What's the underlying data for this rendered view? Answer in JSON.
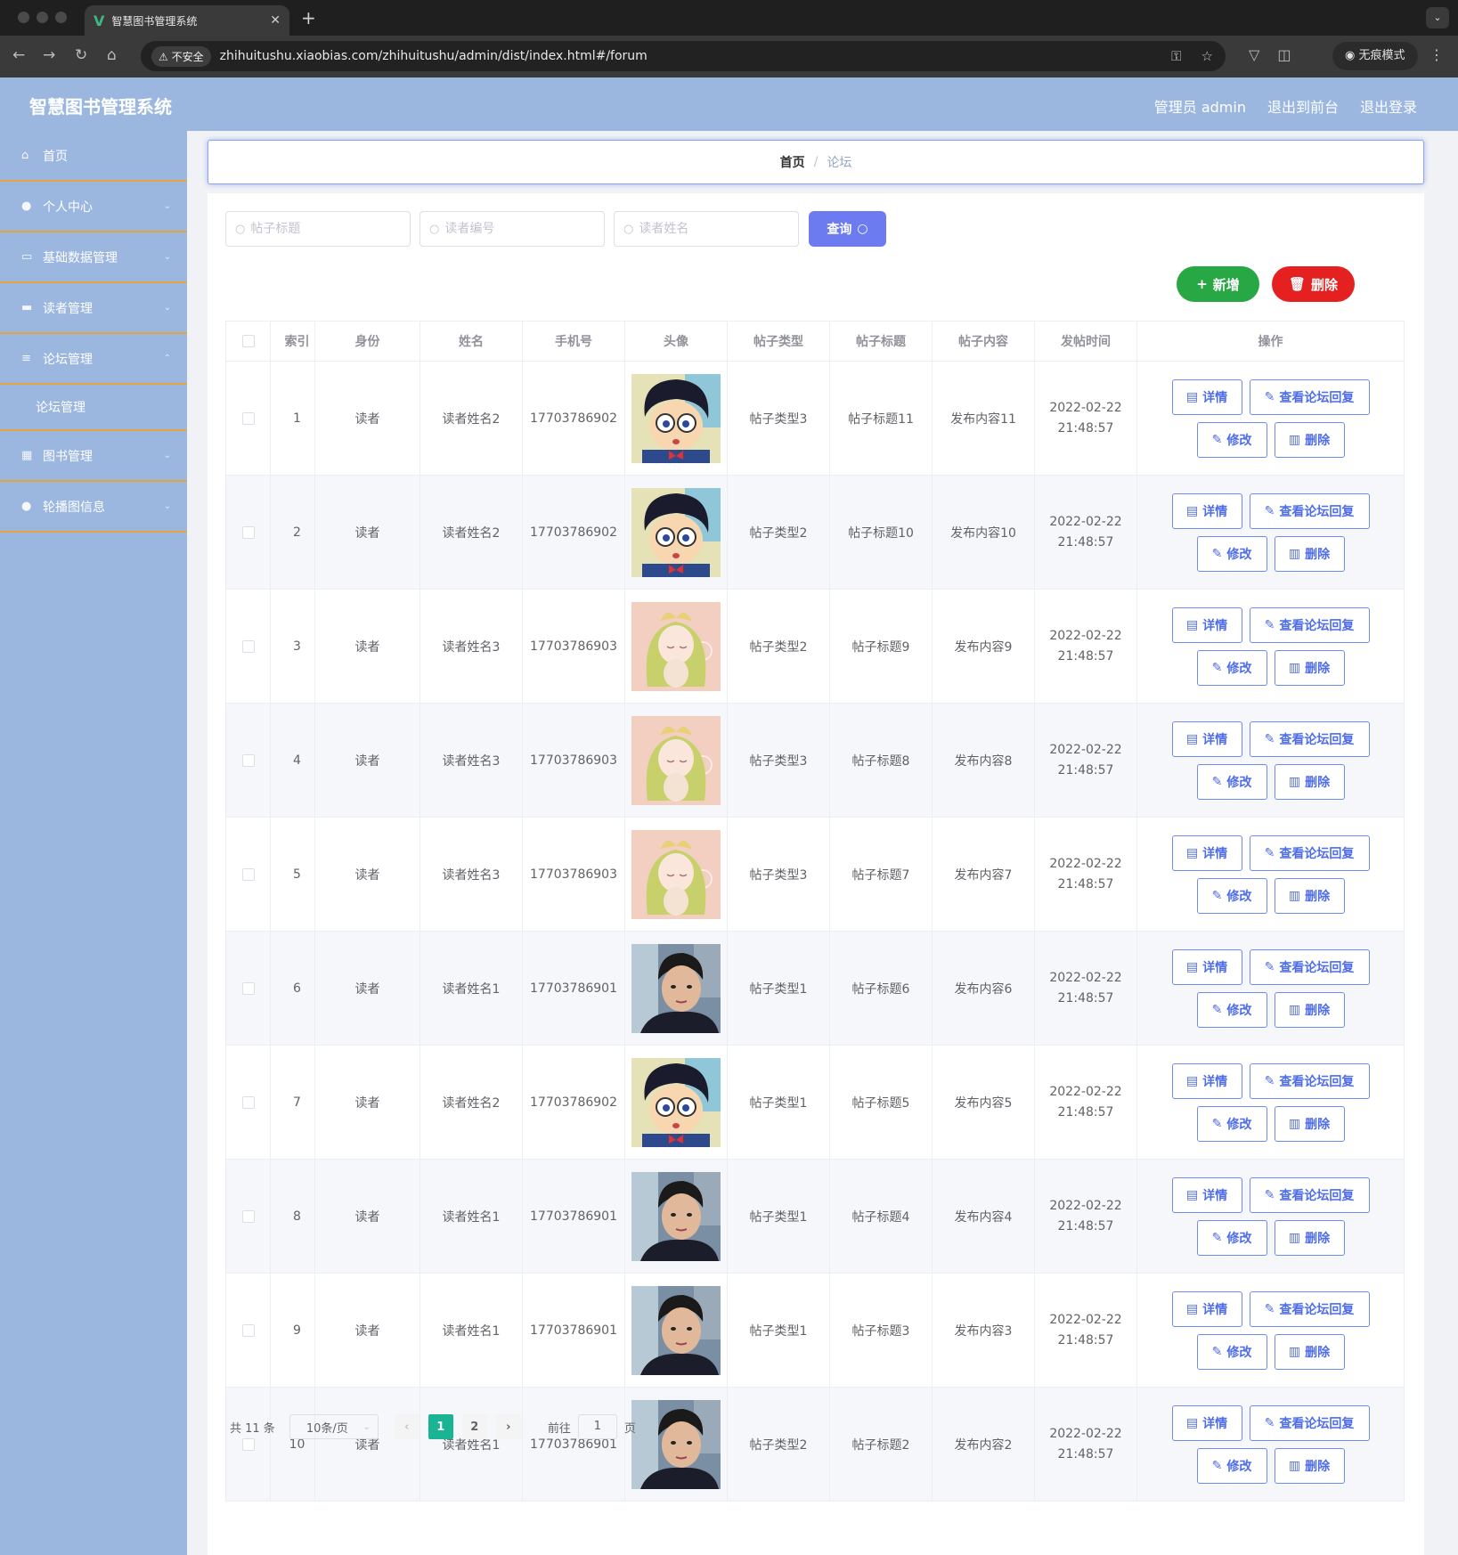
{
  "browser": {
    "tab_title": "智慧图书管理系统",
    "insecure_label": "不安全",
    "url": "zhihuitushu.xiaobias.com/zhihuitushu/admin/dist/index.html#/forum",
    "incognito_label": "无痕模式"
  },
  "header": {
    "title": "智慧图书管理系统",
    "admin_label": "管理员 admin",
    "back_front_label": "退出到前台",
    "logout_label": "退出登录"
  },
  "sidebar": {
    "items": [
      {
        "label": "首页",
        "icon": "home-icon"
      },
      {
        "label": "个人中心",
        "icon": "user-icon"
      },
      {
        "label": "基础数据管理",
        "icon": "chat-icon"
      },
      {
        "label": "读者管理",
        "icon": "briefcase-icon"
      },
      {
        "label": "论坛管理",
        "icon": "menu-icon"
      },
      {
        "label": "图书管理",
        "icon": "grid-icon"
      },
      {
        "label": "轮播图信息",
        "icon": "pin-icon"
      }
    ],
    "submenu_forum": "论坛管理"
  },
  "breadcrumb": {
    "home": "首页",
    "current": "论坛"
  },
  "search": {
    "title_placeholder": "帖子标题",
    "reader_no_placeholder": "读者编号",
    "reader_name_placeholder": "读者姓名",
    "query_label": "查询"
  },
  "actions": {
    "add_label": "新增",
    "delete_label": "删除"
  },
  "table": {
    "headers": [
      "索引",
      "身份",
      "姓名",
      "手机号",
      "头像",
      "帖子类型",
      "帖子标题",
      "帖子内容",
      "发帖时间",
      "操作"
    ],
    "op_labels": {
      "detail": "详情",
      "reply": "查看论坛回复",
      "edit": "修改",
      "delete": "删除"
    },
    "rows": [
      {
        "index": "1",
        "role": "读者",
        "name": "读者姓名2",
        "phone": "17703786902",
        "avatar": "cartoon-boy",
        "type": "帖子类型3",
        "title": "帖子标题11",
        "content": "发布内容11",
        "date": "2022-02-22",
        "time": "21:48:57"
      },
      {
        "index": "2",
        "role": "读者",
        "name": "读者姓名2",
        "phone": "17703786902",
        "avatar": "cartoon-boy",
        "type": "帖子类型2",
        "title": "帖子标题10",
        "content": "发布内容10",
        "date": "2022-02-22",
        "time": "21:48:57"
      },
      {
        "index": "3",
        "role": "读者",
        "name": "读者姓名3",
        "phone": "17703786903",
        "avatar": "anime-girl",
        "type": "帖子类型2",
        "title": "帖子标题9",
        "content": "发布内容9",
        "date": "2022-02-22",
        "time": "21:48:57"
      },
      {
        "index": "4",
        "role": "读者",
        "name": "读者姓名3",
        "phone": "17703786903",
        "avatar": "anime-girl",
        "type": "帖子类型3",
        "title": "帖子标题8",
        "content": "发布内容8",
        "date": "2022-02-22",
        "time": "21:48:57"
      },
      {
        "index": "5",
        "role": "读者",
        "name": "读者姓名3",
        "phone": "17703786903",
        "avatar": "anime-girl",
        "type": "帖子类型3",
        "title": "帖子标题7",
        "content": "发布内容7",
        "date": "2022-02-22",
        "time": "21:48:57"
      },
      {
        "index": "6",
        "role": "读者",
        "name": "读者姓名1",
        "phone": "17703786901",
        "avatar": "man-photo",
        "type": "帖子类型1",
        "title": "帖子标题6",
        "content": "发布内容6",
        "date": "2022-02-22",
        "time": "21:48:57"
      },
      {
        "index": "7",
        "role": "读者",
        "name": "读者姓名2",
        "phone": "17703786902",
        "avatar": "cartoon-boy",
        "type": "帖子类型1",
        "title": "帖子标题5",
        "content": "发布内容5",
        "date": "2022-02-22",
        "time": "21:48:57"
      },
      {
        "index": "8",
        "role": "读者",
        "name": "读者姓名1",
        "phone": "17703786901",
        "avatar": "man-photo",
        "type": "帖子类型1",
        "title": "帖子标题4",
        "content": "发布内容4",
        "date": "2022-02-22",
        "time": "21:48:57"
      },
      {
        "index": "9",
        "role": "读者",
        "name": "读者姓名1",
        "phone": "17703786901",
        "avatar": "man-photo",
        "type": "帖子类型1",
        "title": "帖子标题3",
        "content": "发布内容3",
        "date": "2022-02-22",
        "time": "21:48:57"
      },
      {
        "index": "10",
        "role": "读者",
        "name": "读者姓名1",
        "phone": "17703786901",
        "avatar": "man-photo",
        "type": "帖子类型2",
        "title": "帖子标题2",
        "content": "发布内容2",
        "date": "2022-02-22",
        "time": "21:48:57"
      }
    ]
  },
  "pagination": {
    "total_text": "共 11 条",
    "page_size": "10条/页",
    "pages": [
      "1",
      "2"
    ],
    "current_page": "1",
    "goto_label": "前往",
    "goto_value": "1",
    "page_suffix": "页"
  },
  "colors": {
    "header_bg": "#9bb7e0",
    "accent": "#6c7cf0",
    "add": "#28a745",
    "delete": "#e52020",
    "active_page": "#1ab394",
    "menu_divider": "#e6a23c"
  }
}
